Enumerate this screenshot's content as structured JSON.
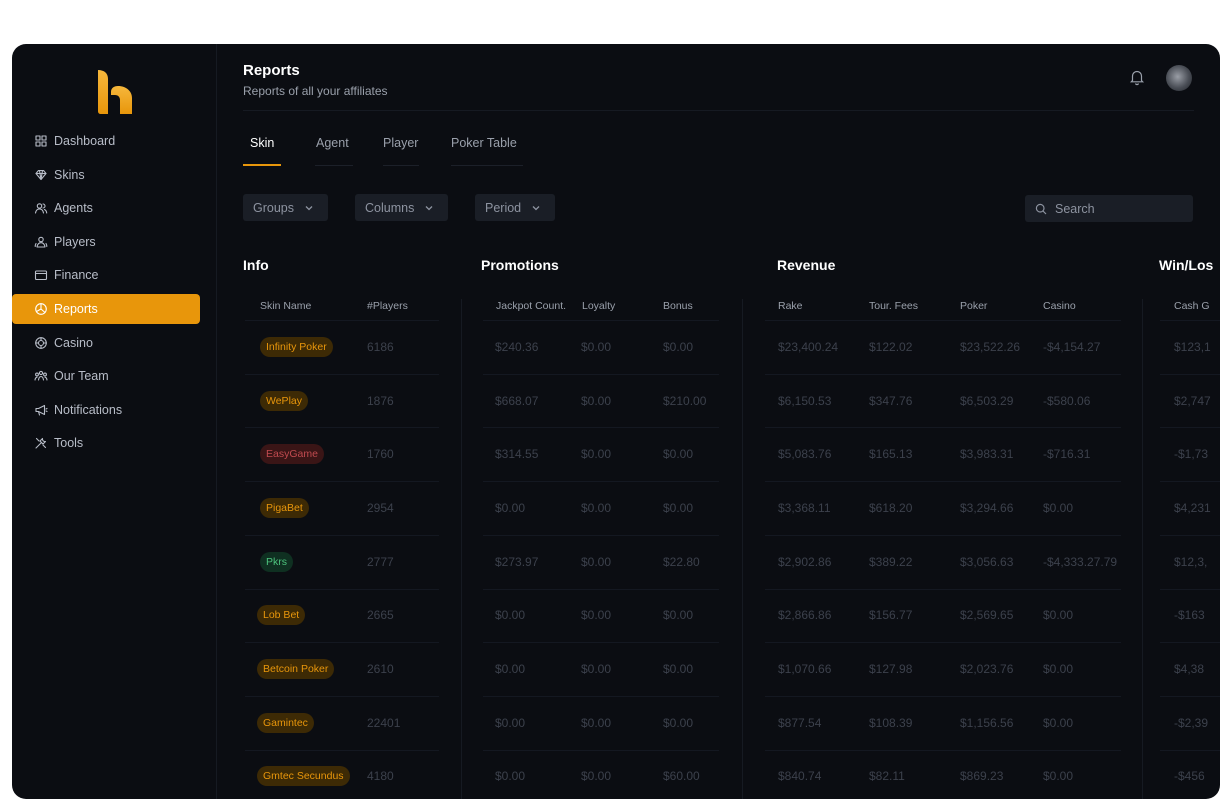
{
  "colors": {
    "accent": "#e8960b",
    "background": "#0b0d12",
    "badge_orange_bg": "#3d2a05",
    "badge_orange_text": "#e8960b",
    "badge_red_bg": "#3a1516",
    "badge_red_text": "#c04a4f",
    "badge_green_bg": "#0f3021",
    "badge_green_text": "#4cc27c"
  },
  "sidebar": {
    "items": [
      {
        "label": "Dashboard",
        "icon": "grid-icon"
      },
      {
        "label": "Skins",
        "icon": "diamond-icon"
      },
      {
        "label": "Agents",
        "icon": "users-icon"
      },
      {
        "label": "Players",
        "icon": "users-group-icon"
      },
      {
        "label": "Finance",
        "icon": "wallet-icon"
      },
      {
        "label": "Reports",
        "icon": "pie-chart-icon",
        "active": true
      },
      {
        "label": "Casino",
        "icon": "chip-icon"
      },
      {
        "label": "Our Team",
        "icon": "team-icon"
      },
      {
        "label": "Notifications",
        "icon": "megaphone-icon"
      },
      {
        "label": "Tools",
        "icon": "tools-icon"
      }
    ]
  },
  "header": {
    "title": "Reports",
    "subtitle": "Reports of all your affiliates"
  },
  "tabs": [
    {
      "label": "Skin",
      "active": true
    },
    {
      "label": "Agent"
    },
    {
      "label": "Player"
    },
    {
      "label": "Poker Table"
    }
  ],
  "filters": {
    "groups": "Groups",
    "columns": "Columns",
    "period": "Period"
  },
  "search": {
    "placeholder": "Search"
  },
  "sections": {
    "info": "Info",
    "promotions": "Promotions",
    "revenue": "Revenue",
    "winloss": "Win/Los"
  },
  "columns": {
    "skin_name": "Skin Name",
    "players": "#Players",
    "jackpot": "Jackpot Count.",
    "loyalty": "Loyalty",
    "bonus": "Bonus",
    "rake": "Rake",
    "tour_fees": "Tour. Fees",
    "poker": "Poker",
    "casino": "Casino",
    "cash": "Cash G"
  },
  "rows": [
    {
      "skin": "Infinity Poker",
      "tone": "orange",
      "players": "6186",
      "jackpot": "$240.36",
      "loyalty": "$0.00",
      "bonus": "$0.00",
      "rake": "$23,400.24",
      "tour": "$122.02",
      "poker": "$23,522.26",
      "casino": "-$4,154.27",
      "cash": "$123,1"
    },
    {
      "skin": "WePlay",
      "tone": "orange",
      "players": "1876",
      "jackpot": "$668.07",
      "loyalty": "$0.00",
      "bonus": "$210.00",
      "rake": "$6,150.53",
      "tour": "$347.76",
      "poker": "$6,503.29",
      "casino": "-$580.06",
      "cash": "$2,747"
    },
    {
      "skin": "EasyGame",
      "tone": "red",
      "players": "1760",
      "jackpot": "$314.55",
      "loyalty": "$0.00",
      "bonus": "$0.00",
      "rake": "$5,083.76",
      "tour": "$165.13",
      "poker": "$3,983.31",
      "casino": "-$716.31",
      "cash": "-$1,73"
    },
    {
      "skin": "PigaBet",
      "tone": "orange",
      "players": "2954",
      "jackpot": "$0.00",
      "loyalty": "$0.00",
      "bonus": "$0.00",
      "rake": "$3,368.11",
      "tour": "$618.20",
      "poker": "$3,294.66",
      "casino": "$0.00",
      "cash": "$4,231"
    },
    {
      "skin": "Pkrs",
      "tone": "green",
      "players": "2777",
      "jackpot": "$273.97",
      "loyalty": "$0.00",
      "bonus": "$22.80",
      "rake": "$2,902.86",
      "tour": "$389.22",
      "poker": "$3,056.63",
      "casino": "-$4,333.27.79",
      "cash": "$12,3,"
    },
    {
      "skin": "Lob Bet",
      "tone": "orange",
      "players": "2665",
      "jackpot": "$0.00",
      "loyalty": "$0.00",
      "bonus": "$0.00",
      "rake": "$2,866.86",
      "tour": "$156.77",
      "poker": "$2,569.65",
      "casino": "$0.00",
      "cash": "-$163"
    },
    {
      "skin": "Betcoin Poker",
      "tone": "orange",
      "players": "2610",
      "jackpot": "$0.00",
      "loyalty": "$0.00",
      "bonus": "$0.00",
      "rake": "$1,070.66",
      "tour": "$127.98",
      "poker": "$2,023.76",
      "casino": "$0.00",
      "cash": "$4,38"
    },
    {
      "skin": "Gamintec",
      "tone": "orange",
      "players": "22401",
      "jackpot": "$0.00",
      "loyalty": "$0.00",
      "bonus": "$0.00",
      "rake": "$877.54",
      "tour": "$108.39",
      "poker": "$1,156.56",
      "casino": "$0.00",
      "cash": "-$2,39"
    },
    {
      "skin": "Gmtec Secundus",
      "tone": "orange",
      "players": "4180",
      "jackpot": "$0.00",
      "loyalty": "$0.00",
      "bonus": "$60.00",
      "rake": "$840.74",
      "tour": "$82.11",
      "poker": "$869.23",
      "casino": "$0.00",
      "cash": "-$456"
    }
  ]
}
